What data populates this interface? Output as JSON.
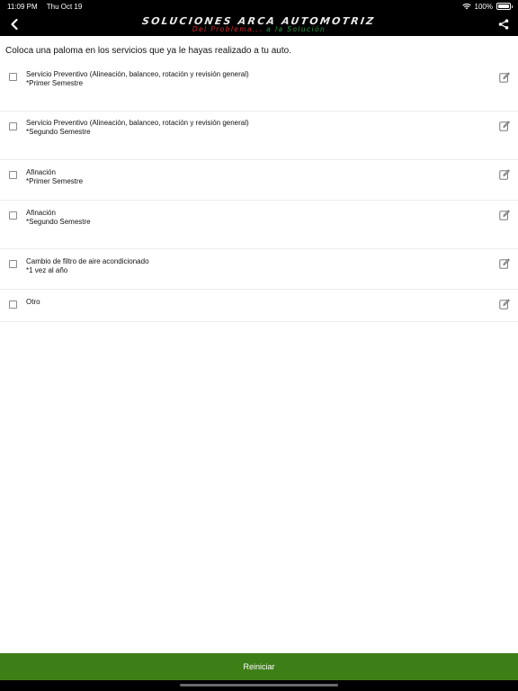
{
  "status_bar": {
    "time": "11:09 PM",
    "date": "Thu Oct 19",
    "battery": "100%",
    "icons": [
      "wifi-icon",
      "battery-icon"
    ]
  },
  "header": {
    "brand_title": "SOLUCIONES ARCA AUTOMOTRIZ",
    "brand_subtitle_red": "Del Problema...",
    "brand_subtitle_green": " a la Solución",
    "icons": [
      "chevron-left-icon",
      "share-icon"
    ]
  },
  "instruction": "Coloca una paloma en los servicios que ya le hayas realizado a tu auto.",
  "services": [
    {
      "title": "Servicio Preventivo (Alineación, balanceo, rotación y revisión general)",
      "note": "*Primer Semestre",
      "checked": false
    },
    {
      "title": "Servicio Preventivo (Alineación, balanceo, rotación y revisión general)",
      "note": "*Segundo Semestre",
      "checked": false
    },
    {
      "title": "Afinación",
      "note": "*Primer Semestre",
      "checked": false
    },
    {
      "title": "Afinación",
      "note": "*Segundo Semestre",
      "checked": false
    },
    {
      "title": "Cambio de filtro de aire acondicionado",
      "note": "*1 vez al año",
      "checked": false
    },
    {
      "title": "Otro",
      "note": "",
      "checked": false
    }
  ],
  "footer": {
    "reset_label": "Reiniciar"
  },
  "colors": {
    "accent_green": "#3e7e17",
    "brand_red": "#d2232a",
    "brand_green": "#1f9c3a"
  }
}
